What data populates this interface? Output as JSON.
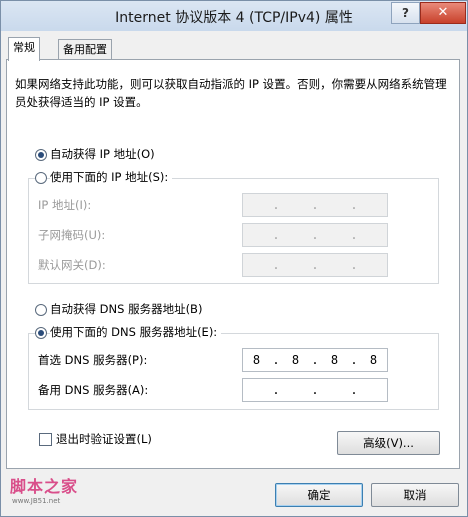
{
  "window": {
    "title": "Internet 协议版本 4 (TCP/IPv4) 属性",
    "help_label": "?",
    "close_label": "✕"
  },
  "tabs": [
    {
      "label": "常规"
    },
    {
      "label": "备用配置"
    }
  ],
  "description": "如果网络支持此功能，则可以获取自动指派的 IP 设置。否则，你需要从网络系统管理员处获得适当的 IP 设置。",
  "ip_section": {
    "auto_label": "自动获得 IP 地址(O)",
    "manual_label": "使用下面的 IP 地址(S):",
    "selected": "auto",
    "fields": [
      {
        "label": "IP 地址(I):",
        "octets": [
          "",
          "",
          "",
          ""
        ]
      },
      {
        "label": "子网掩码(U):",
        "octets": [
          "",
          "",
          "",
          ""
        ]
      },
      {
        "label": "默认网关(D):",
        "octets": [
          "",
          "",
          "",
          ""
        ]
      }
    ]
  },
  "dns_section": {
    "auto_label": "自动获得 DNS 服务器地址(B)",
    "manual_label": "使用下面的 DNS 服务器地址(E):",
    "selected": "manual",
    "preferred": {
      "label": "首选 DNS 服务器(P):",
      "octets": [
        "8",
        "8",
        "8",
        "8"
      ]
    },
    "alternate": {
      "label": "备用 DNS 服务器(A):",
      "octets": [
        "",
        "",
        "",
        ""
      ]
    }
  },
  "validate_label": "退出时验证设置(L)",
  "validate_checked": false,
  "advanced_label": "高级(V)...",
  "ok_label": "确定",
  "cancel_label": "取消",
  "watermark": {
    "main": "脚本之家",
    "sub": "www.JB51.net"
  }
}
